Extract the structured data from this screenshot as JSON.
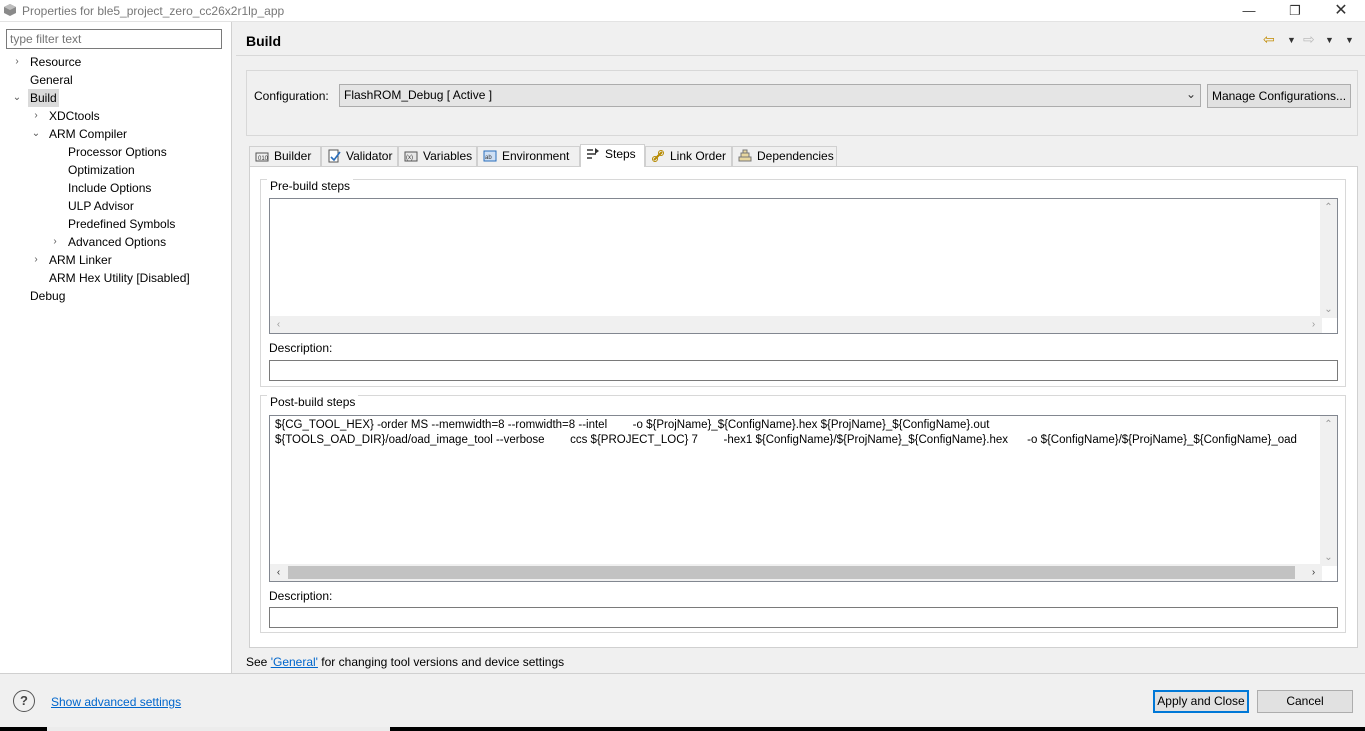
{
  "window": {
    "title": "Properties for ble5_project_zero_cc26x2r1lp_app",
    "minimize_glyph": "—",
    "maximize_glyph": "❐",
    "close_glyph": "✕"
  },
  "filter": {
    "placeholder": "type filter text"
  },
  "tree": [
    {
      "label": "Resource",
      "level": 0,
      "arrow": "›"
    },
    {
      "label": "General",
      "level": 0,
      "arrow": ""
    },
    {
      "label": "Build",
      "level": 0,
      "arrow": "⌄",
      "selected": true
    },
    {
      "label": "XDCtools",
      "level": 1,
      "arrow": "›"
    },
    {
      "label": "ARM Compiler",
      "level": 1,
      "arrow": "⌄"
    },
    {
      "label": "Processor Options",
      "level": 2,
      "arrow": ""
    },
    {
      "label": "Optimization",
      "level": 2,
      "arrow": ""
    },
    {
      "label": "Include Options",
      "level": 2,
      "arrow": ""
    },
    {
      "label": "ULP Advisor",
      "level": 2,
      "arrow": ""
    },
    {
      "label": "Predefined Symbols",
      "level": 2,
      "arrow": ""
    },
    {
      "label": "Advanced Options",
      "level": 2,
      "arrow": "›"
    },
    {
      "label": "ARM Linker",
      "level": 1,
      "arrow": "›"
    },
    {
      "label": "ARM Hex Utility  [Disabled]",
      "level": 1,
      "arrow": ""
    },
    {
      "label": "Debug",
      "level": 0,
      "arrow": ""
    }
  ],
  "header": {
    "title": "Build"
  },
  "configuration": {
    "label": "Configuration:",
    "value": "FlashROM_Debug  [ Active ]",
    "manage_label": "Manage Configurations..."
  },
  "tabs": [
    {
      "label": "Builder",
      "icon": "builder-icon"
    },
    {
      "label": "Validator",
      "icon": "validator-icon"
    },
    {
      "label": "Variables",
      "icon": "variables-icon"
    },
    {
      "label": "Environment",
      "icon": "environment-icon"
    },
    {
      "label": "Steps",
      "icon": "steps-icon",
      "active": true
    },
    {
      "label": "Link Order",
      "icon": "link-order-icon"
    },
    {
      "label": "Dependencies",
      "icon": "dependencies-icon"
    }
  ],
  "prebuild": {
    "title": "Pre-build steps",
    "lines": [],
    "description_label": "Description:",
    "description_value": ""
  },
  "postbuild": {
    "title": "Post-build steps",
    "lines": [
      "${CG_TOOL_HEX} -order MS --memwidth=8 --romwidth=8 --intel        -o ${ProjName}_${ConfigName}.hex ${ProjName}_${ConfigName}.out",
      "${TOOLS_OAD_DIR}/oad/oad_image_tool --verbose        ccs ${PROJECT_LOC} 7        -hex1 ${ConfigName}/${ProjName}_${ConfigName}.hex      -o ${ConfigName}/${ProjName}_${ConfigName}_oad"
    ],
    "description_label": "Description:",
    "description_value": ""
  },
  "footer_note": {
    "prefix": "See ",
    "link": "'General'",
    "suffix": " for changing tool versions and device settings"
  },
  "bottom": {
    "help_glyph": "?",
    "advanced_link": "Show advanced settings",
    "apply_label": "Apply and Close",
    "cancel_label": "Cancel"
  },
  "colors": {
    "accent": "#0078d7",
    "link": "#0066cc",
    "selection": "#dadada"
  }
}
